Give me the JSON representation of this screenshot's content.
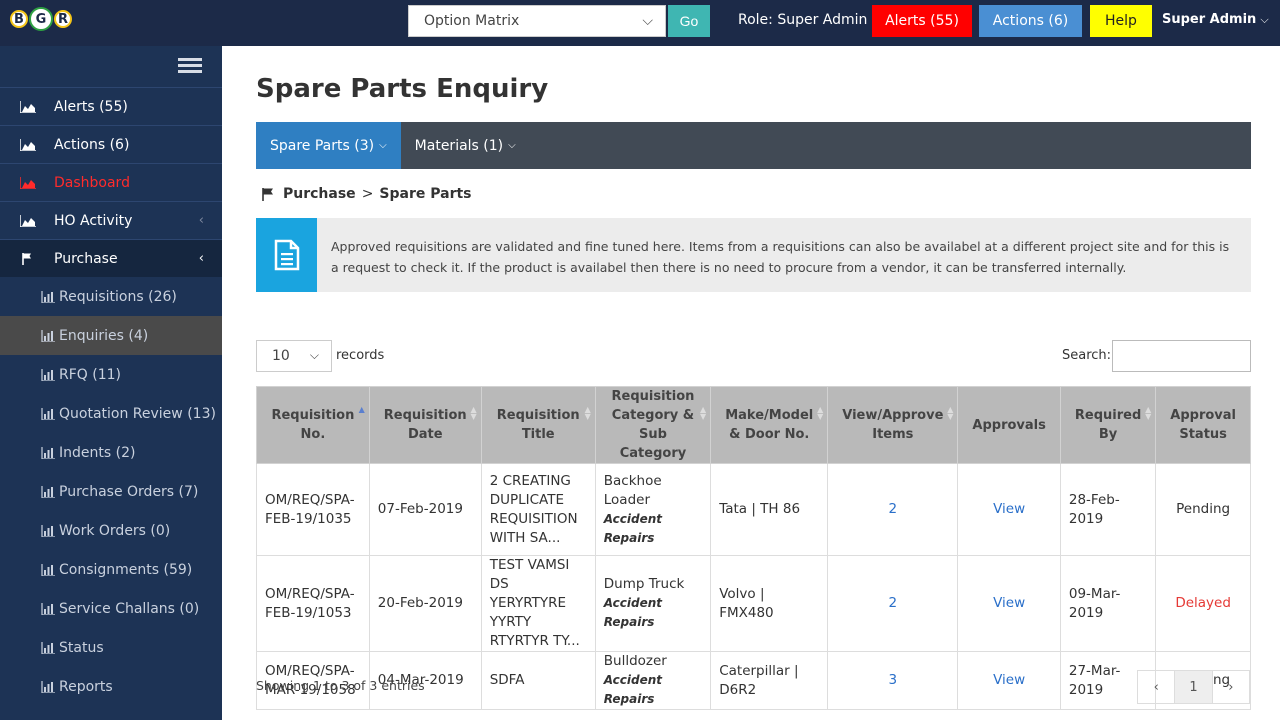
{
  "header": {
    "logo_letters": [
      "B",
      "G",
      "R"
    ],
    "project_select": "Option Matrix",
    "go_label": "Go",
    "role": "Role: Super Admin",
    "alerts_label": "Alerts (55)",
    "actions_label": "Actions (6)",
    "help_label": "Help",
    "user": "Super Admin"
  },
  "sidebar": {
    "items": [
      {
        "label": "Alerts (55)"
      },
      {
        "label": "Actions (6)"
      },
      {
        "label": "Dashboard"
      },
      {
        "label": "HO Activity"
      },
      {
        "label": "Purchase"
      }
    ],
    "subitems": [
      {
        "label": "Requisitions (26)"
      },
      {
        "label": "Enquiries (4)"
      },
      {
        "label": "RFQ (11)"
      },
      {
        "label": "Quotation Review (13)"
      },
      {
        "label": "Indents (2)"
      },
      {
        "label": "Purchase Orders (7)"
      },
      {
        "label": "Work Orders (0)"
      },
      {
        "label": "Consignments (59)"
      },
      {
        "label": "Service Challans (0)"
      },
      {
        "label": "Status"
      },
      {
        "label": "Reports"
      }
    ]
  },
  "main": {
    "title": "Spare Parts Enquiry",
    "tabs": [
      {
        "label": "Spare Parts (3)"
      },
      {
        "label": "Materials (1)"
      }
    ],
    "breadcrumb": {
      "parent": "Purchase",
      "separator": ">",
      "current": "Spare Parts"
    },
    "info_text": "Approved requisitions are validated and fine tuned here. Items from a requisitions can also be availabel at a different project site and for this is a request to check it. If the product is availabel then there is no need to procure from a vendor, it can be transferred internally.",
    "page_length": "10",
    "records_label": "records",
    "search_label": "Search:",
    "search_value": "",
    "columns": [
      "Requisition No.",
      "Requisition Date",
      "Requisition Title",
      "Requisition Category & Sub Category",
      "Make/Model & Door No.",
      "View/Approve Items",
      "Approvals",
      "Required By",
      "Approval Status"
    ],
    "rows": [
      {
        "req_no": "OM/REQ/SPA-FEB-19/1035",
        "date": "07-Feb-2019",
        "title": "2 CREATING DUPLICATE REQUISITION WITH SA...",
        "category": "Backhoe Loader",
        "sub_category": "Accident Repairs",
        "make": "Tata | TH 86",
        "items": "2",
        "approvals": "View",
        "required_by": "28-Feb-2019",
        "status": "Pending"
      },
      {
        "req_no": "OM/REQ/SPA-FEB-19/1053",
        "date": "20-Feb-2019",
        "title": "TEST VAMSI DS YERYRTYRE YYRTY RTYRTYR TY...",
        "category": "Dump Truck",
        "sub_category": "Accident Repairs",
        "make": "Volvo | FMX480",
        "items": "2",
        "approvals": "View",
        "required_by": "09-Mar-2019",
        "status": "Delayed"
      },
      {
        "req_no": "OM/REQ/SPA-MAR-19/1058",
        "date": "04-Mar-2019",
        "title": "SDFA",
        "category": "Bulldozer",
        "sub_category": "Accident Repairs",
        "make": "Caterpillar | D6R2",
        "items": "3",
        "approvals": "View",
        "required_by": "27-Mar-2019",
        "status": "Pending"
      }
    ],
    "footer_info": "Showing 1 to 3 of 3 entries",
    "pager": {
      "prev": "‹",
      "current": "1",
      "next": "›"
    }
  },
  "colors": {
    "topbar": "#1c2a48",
    "sidebar": "#1d3355",
    "alerts": "#ff0000",
    "actions": "#4a8fd3",
    "help": "#ffff00",
    "go": "#3fb6b2",
    "tab_active": "#2f7fc2",
    "tabs_bar": "#414a55",
    "info_icon": "#1aa4df",
    "delayed": "#e53935"
  }
}
